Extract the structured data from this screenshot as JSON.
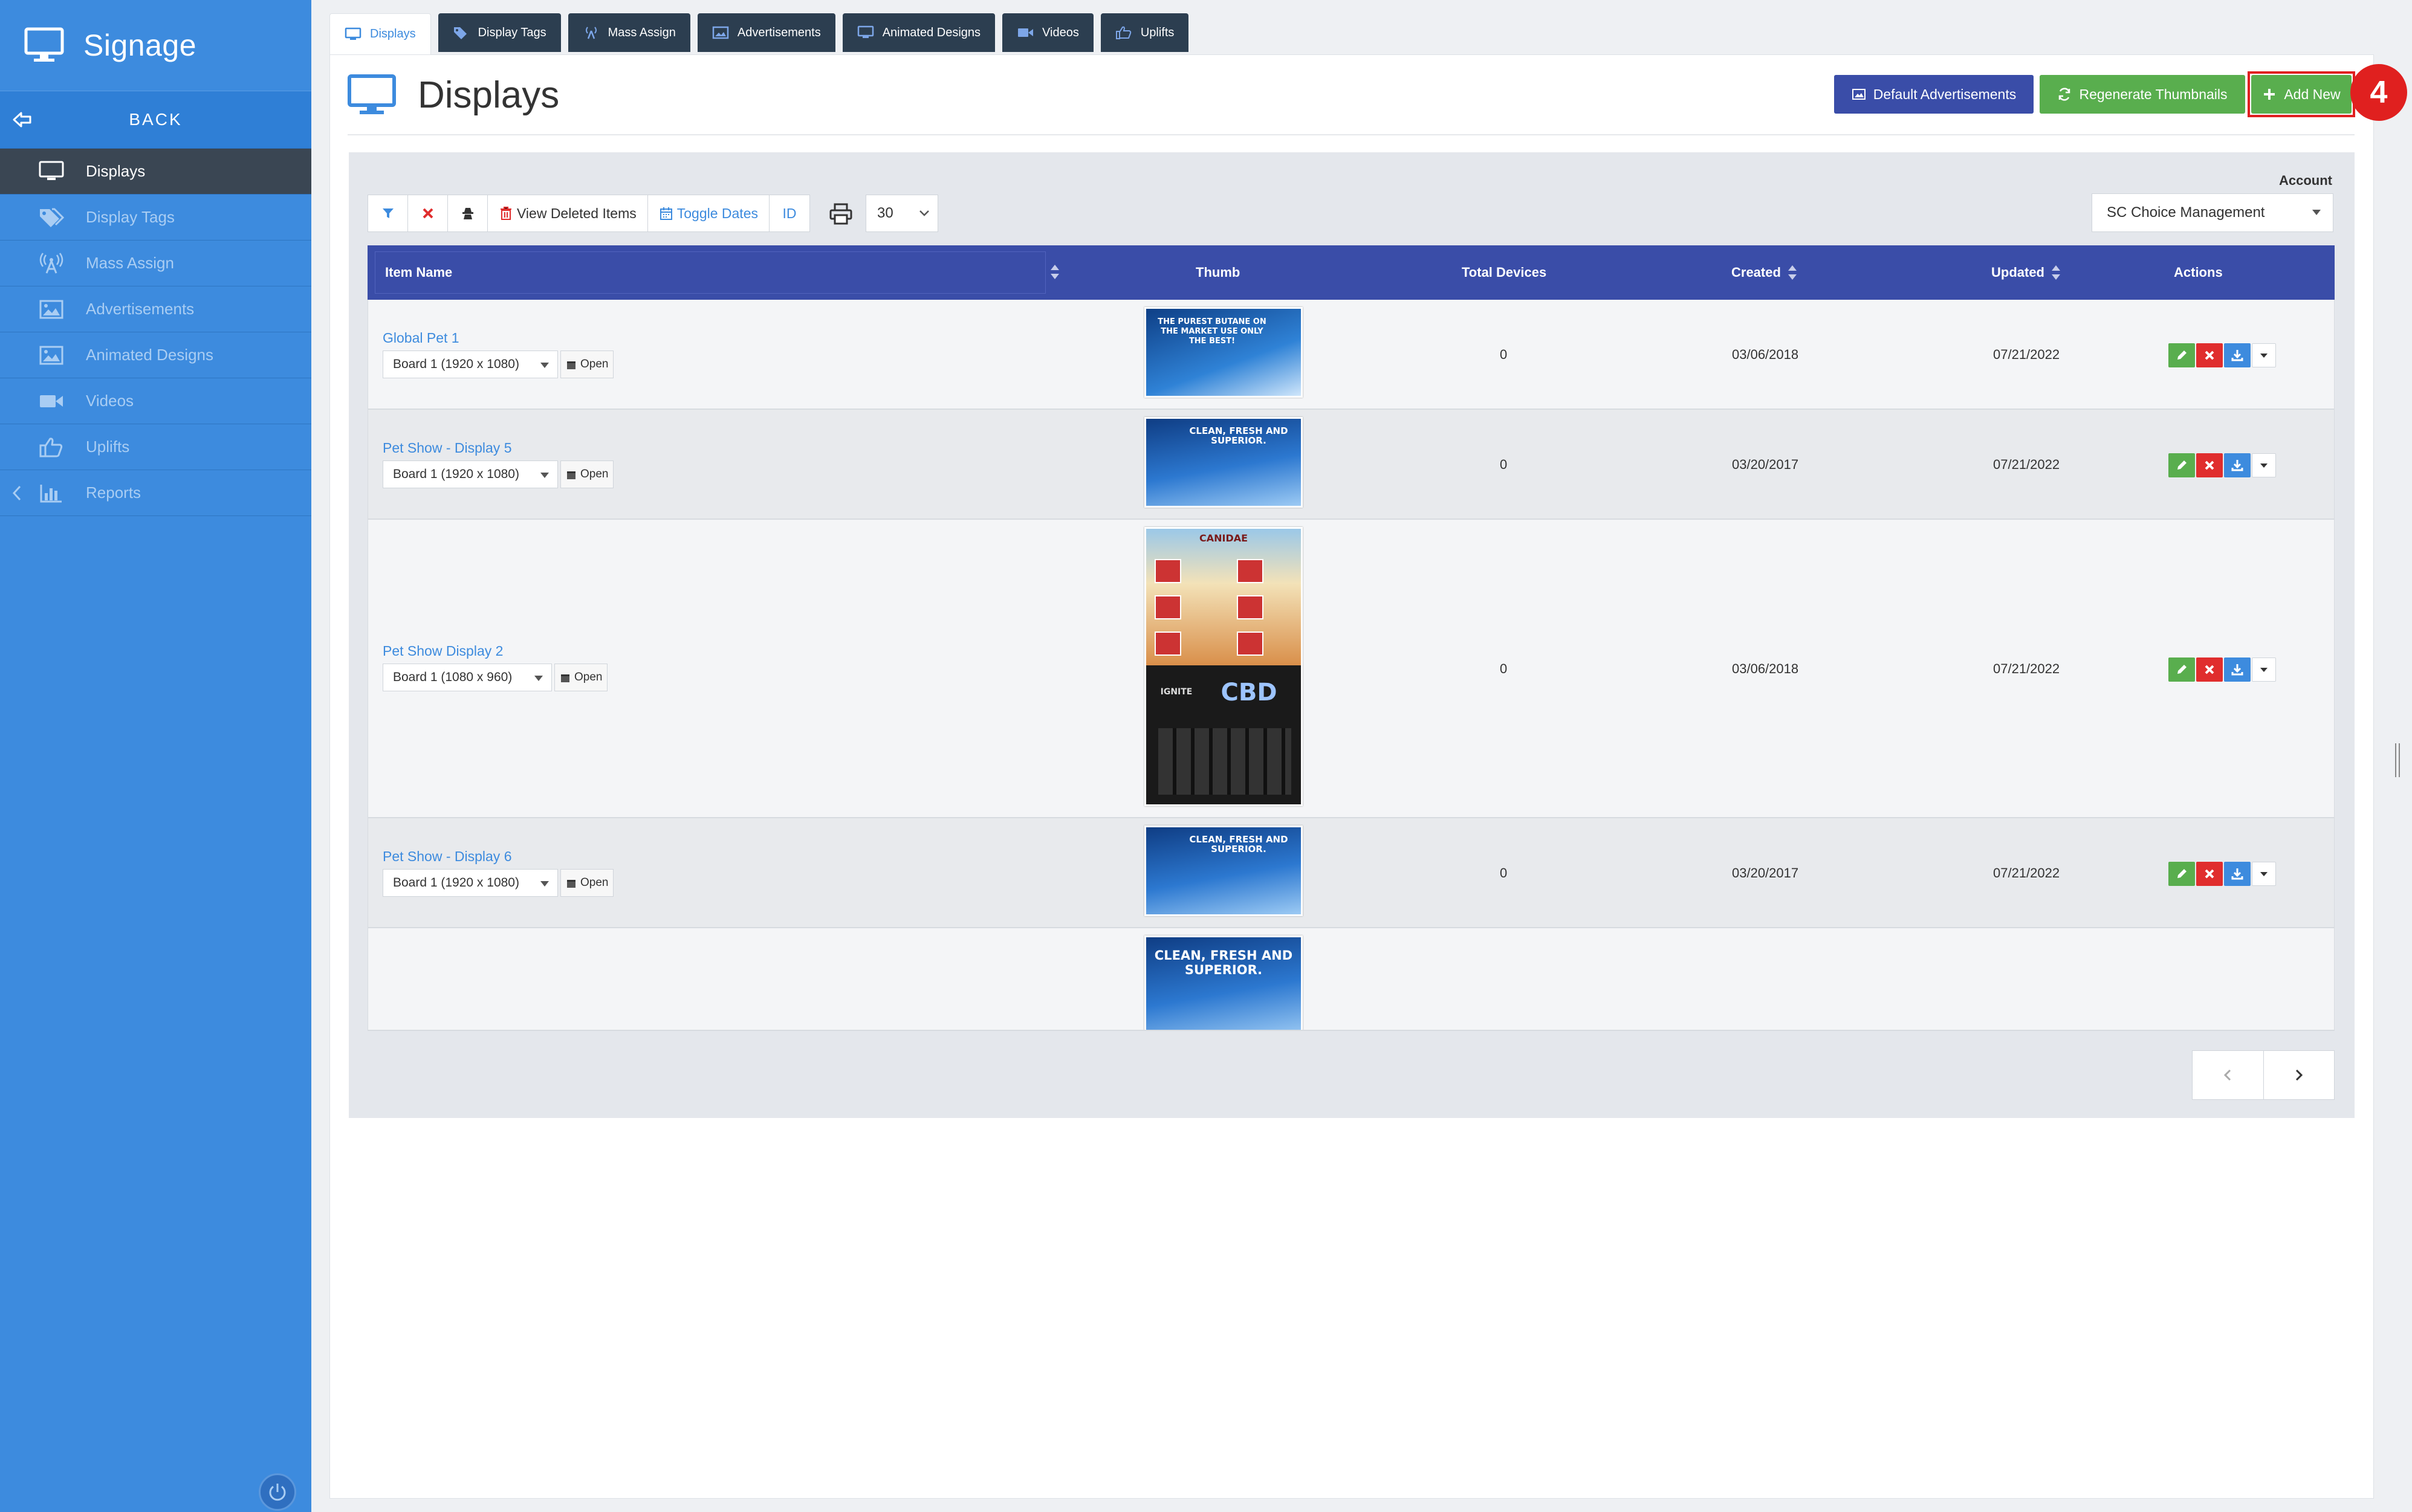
{
  "sidebar": {
    "brand": "Signage",
    "back_label": "BACK",
    "items": [
      {
        "label": "Displays",
        "icon": "monitor-icon",
        "active": true
      },
      {
        "label": "Display Tags",
        "icon": "tags-icon"
      },
      {
        "label": "Mass Assign",
        "icon": "broadcast-icon"
      },
      {
        "label": "Advertisements",
        "icon": "image-icon"
      },
      {
        "label": "Animated Designs",
        "icon": "image-icon"
      },
      {
        "label": "Videos",
        "icon": "video-icon"
      },
      {
        "label": "Uplifts",
        "icon": "thumbs-up-icon"
      },
      {
        "label": "Reports",
        "icon": "bar-chart-icon"
      }
    ]
  },
  "tabs": [
    {
      "label": "Displays",
      "active": true
    },
    {
      "label": "Display Tags"
    },
    {
      "label": "Mass Assign"
    },
    {
      "label": "Advertisements"
    },
    {
      "label": "Animated Designs"
    },
    {
      "label": "Videos"
    },
    {
      "label": "Uplifts"
    }
  ],
  "page": {
    "title": "Displays",
    "buttons": {
      "default_ads": "Default Advertisements",
      "regenerate": "Regenerate Thumbnails",
      "add_new": "Add New"
    },
    "step_badge": "4"
  },
  "filters": {
    "account_label": "Account",
    "account_value": "SC Choice Management",
    "view_deleted": "View Deleted Items",
    "toggle_dates": "Toggle Dates",
    "id": "ID",
    "per_page": "30"
  },
  "table": {
    "headers": {
      "name": "Item Name",
      "thumb": "Thumb",
      "devices": "Total Devices",
      "created": "Created",
      "updated": "Updated",
      "actions": "Actions"
    },
    "open_label": "Open",
    "rows": [
      {
        "name": "Global Pet 1",
        "board": "Board 1 (1920 x 1080)",
        "devices": "0",
        "created": "03/06/2018",
        "updated": "07/21/2022",
        "thumb_text": "THE PUREST BUTANE ON THE MARKET USE ONLY THE BEST!"
      },
      {
        "name": "Pet Show - Display 5",
        "board": "Board 1 (1920 x 1080)",
        "devices": "0",
        "created": "03/20/2017",
        "updated": "07/21/2022",
        "thumb_text": "CLEAN, FRESH AND SUPERIOR."
      },
      {
        "name": "Pet Show Display 2",
        "board": "Board 1 (1080 x 960)",
        "devices": "0",
        "created": "03/06/2018",
        "updated": "07/21/2022",
        "thumb_text": "CANIDAE",
        "thumb_text2": "CBD",
        "thumb_text3": "IGNITE"
      },
      {
        "name": "Pet Show - Display 6",
        "board": "Board 1 (1920 x 1080)",
        "devices": "0",
        "created": "03/20/2017",
        "updated": "07/21/2022",
        "thumb_text": "CLEAN, FRESH AND SUPERIOR."
      },
      {
        "thumb_text": "CLEAN, FRESH AND SUPERIOR."
      }
    ]
  },
  "colors": {
    "sidebar": "#3d8bde",
    "header": "#3a4da8",
    "success": "#59ae4e",
    "danger": "#e02d2d"
  }
}
